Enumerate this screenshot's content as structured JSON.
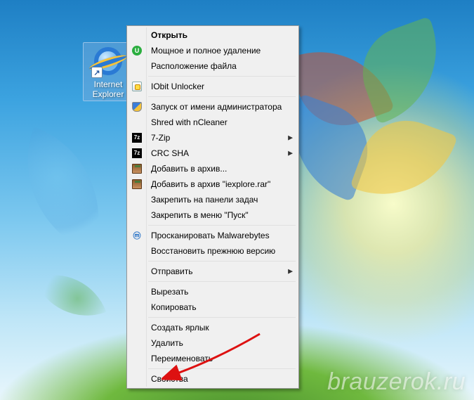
{
  "desktop": {
    "icon_label": "Internet Explorer"
  },
  "menu": {
    "open": "Открыть",
    "full_uninstall": "Мощное и полное удаление",
    "file_location": "Расположение файла",
    "iobit_unlocker": "IObit Unlocker",
    "run_as_admin": "Запуск от имени администратора",
    "shred_ncleaner": "Shred with nCleaner",
    "sevenzip": "7-Zip",
    "crc_sha": "CRC SHA",
    "add_to_archive": "Добавить в архив...",
    "add_to_archive_named": "Добавить в архив \"iexplore.rar\"",
    "pin_taskbar": "Закрепить на панели задач",
    "pin_start": "Закрепить в меню \"Пуск\"",
    "scan_malwarebytes": "Просканировать Malwarebytes",
    "restore_previous": "Восстановить прежнюю версию",
    "send_to": "Отправить",
    "cut": "Вырезать",
    "copy": "Копировать",
    "create_shortcut": "Создать ярлык",
    "delete": "Удалить",
    "rename": "Переименовать",
    "properties": "Свойства"
  },
  "watermark": "brauzerok.ru"
}
